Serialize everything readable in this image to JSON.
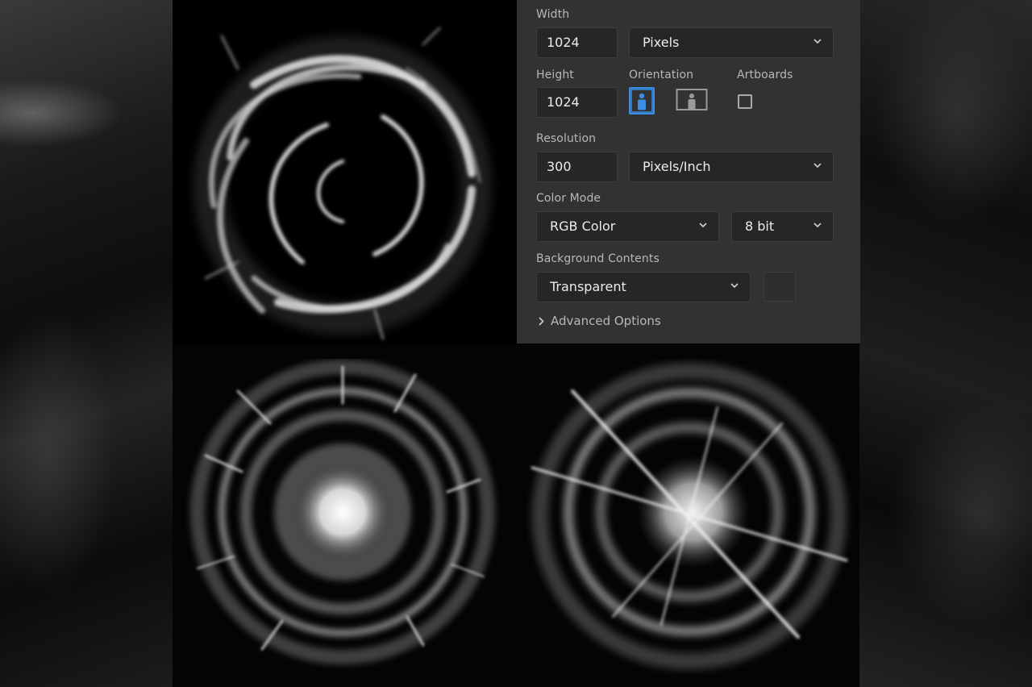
{
  "dialog": {
    "width": {
      "label": "Width",
      "value": "1024",
      "unit": "Pixels"
    },
    "height": {
      "label": "Height",
      "value": "1024"
    },
    "orientation": {
      "label": "Orientation",
      "selected": "portrait"
    },
    "artboards": {
      "label": "Artboards",
      "checked": false
    },
    "resolution": {
      "label": "Resolution",
      "value": "300",
      "unit": "Pixels/Inch"
    },
    "color_mode": {
      "label": "Color Mode",
      "mode": "RGB Color",
      "depth": "8 bit"
    },
    "background": {
      "label": "Background Contents",
      "value": "Transparent"
    },
    "advanced": {
      "label": "Advanced Options"
    }
  },
  "colors": {
    "panel_bg": "#323232",
    "field_bg": "#262626",
    "accent": "#3a8ee6",
    "text": "#ececec",
    "label": "#b8b8b8"
  },
  "icons": [
    "portrait-orientation-icon",
    "landscape-orientation-icon",
    "chevron-down-icon",
    "chevron-right-icon",
    "checkbox-icon"
  ]
}
